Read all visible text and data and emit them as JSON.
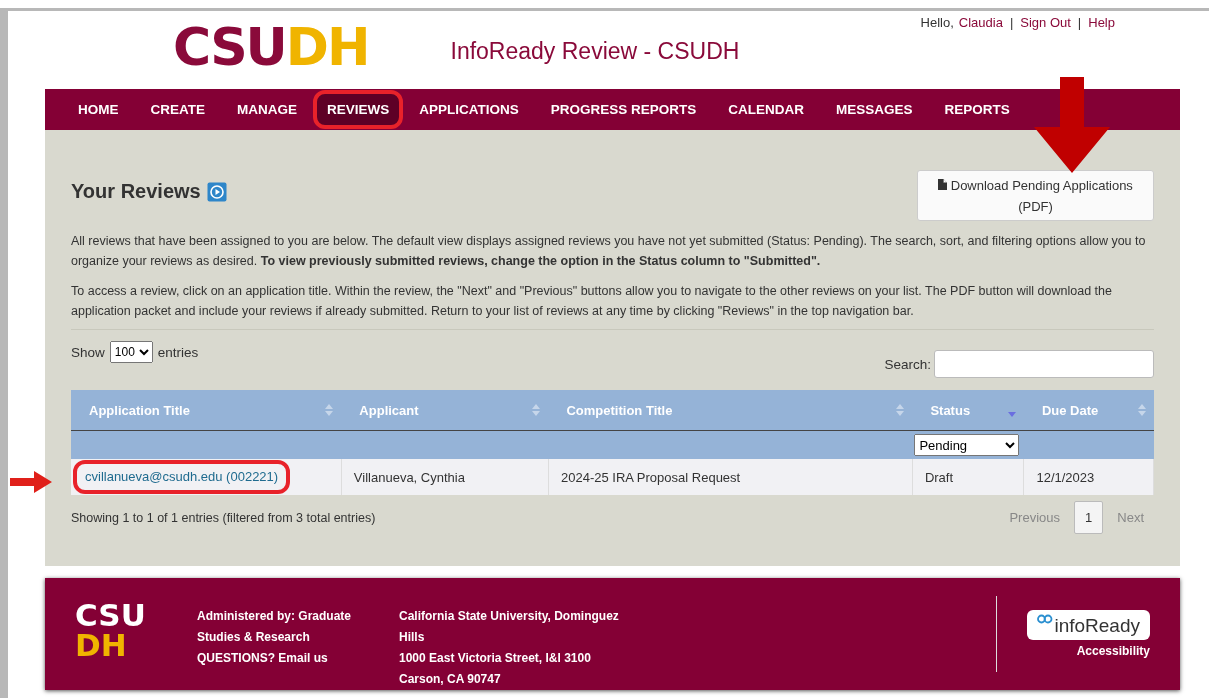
{
  "header": {
    "logo": [
      "CSU",
      "DH"
    ],
    "site_title": "InfoReady Review - CSUDH",
    "greeting": "Hello,",
    "user": "Claudia",
    "links": [
      "Sign Out",
      "Help"
    ],
    "separator": "|"
  },
  "nav": [
    {
      "label": "HOME",
      "selected": false,
      "annotated": false
    },
    {
      "label": "CREATE",
      "selected": false,
      "annotated": false
    },
    {
      "label": "MANAGE",
      "selected": false,
      "annotated": false
    },
    {
      "label": "REVIEWS",
      "selected": true,
      "annotated": true
    },
    {
      "label": "APPLICATIONS",
      "selected": false,
      "annotated": false
    },
    {
      "label": "PROGRESS REPORTS",
      "selected": false,
      "annotated": false
    },
    {
      "label": "CALENDAR",
      "selected": false,
      "annotated": false
    },
    {
      "label": "MESSAGES",
      "selected": false,
      "annotated": false
    },
    {
      "label": "REPORTS",
      "selected": false,
      "annotated": false
    }
  ],
  "page": {
    "title": "Your Reviews",
    "download_button": "Download Pending Applications (PDF)",
    "paragraphs": [
      "All reviews that have been assigned to you are below. The default view displays assigned reviews you have not yet submitted (Status: Pending). The search, sort, and filtering options allow you to organize your reviews as desired. **To view previously submitted reviews, change the option in the Status column to \"Submitted\".**",
      "To access a review, click on an application title. Within the review, the \"Next\" and \"Previous\" buttons allow you to navigate to the other reviews on your list. The PDF button will download the application packet and include your reviews if already submitted. Return to your list of reviews at any time by clicking \"Reviews\" in the top navigation bar."
    ]
  },
  "table": {
    "show_label": "Show",
    "page_size": "100",
    "entries_label": "entries",
    "search_label": "Search:",
    "columns": [
      {
        "label": "Application Title",
        "sorted": false
      },
      {
        "label": "Applicant",
        "sorted": false
      },
      {
        "label": "Competition Title",
        "sorted": false
      },
      {
        "label": "Status",
        "sorted": true
      },
      {
        "label": "Due Date",
        "sorted": false
      }
    ],
    "status_filter": "Pending",
    "rows": [
      {
        "application_title": "cvillanueva@csudh.edu (002221)",
        "applicant": "Villanueva, Cynthia",
        "competition_title": "2024-25 IRA Proposal Request",
        "status": "Draft",
        "due_date": "12/1/2023",
        "annotated": true
      }
    ],
    "info": "Showing 1 to 1 of 1 entries (filtered from 3 total entries)",
    "pagination": {
      "previous": "Previous",
      "page": "1",
      "next": "Next"
    }
  },
  "footer": {
    "logo": [
      "CSU",
      "DH"
    ],
    "admin": [
      "Administered by: Graduate Studies & Research",
      "QUESTIONS? Email us"
    ],
    "address": [
      "California State University, Dominguez Hills",
      "1000 East Victoria Street, I&I 3100",
      "Carson, CA 90747"
    ],
    "badge": "infoReady",
    "accessibility": "Accessibility"
  }
}
